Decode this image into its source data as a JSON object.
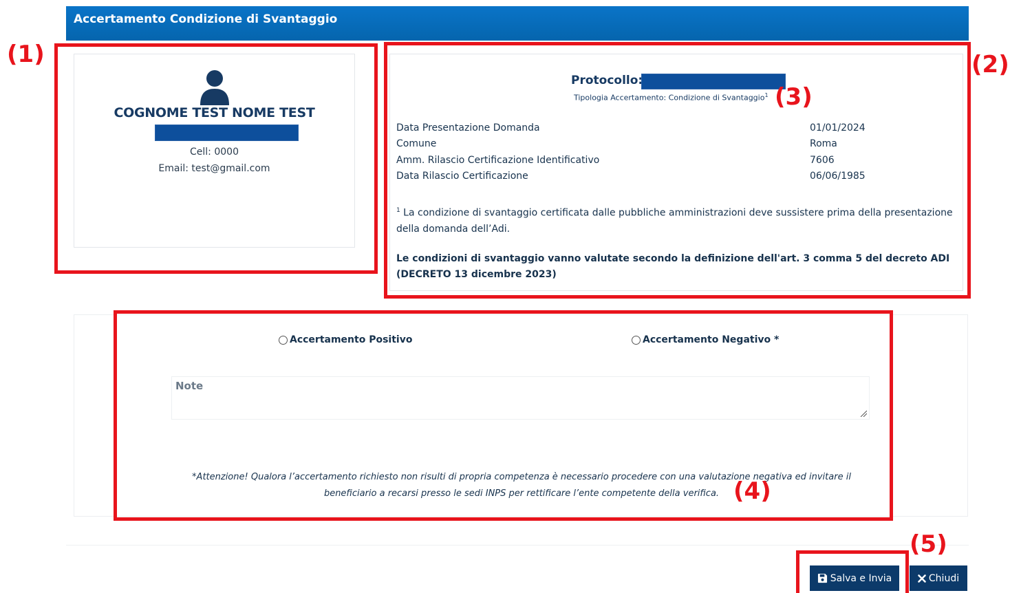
{
  "header": {
    "title": "Accertamento Condizione di Svantaggio"
  },
  "markers": {
    "m1": "(1)",
    "m2": "(2)",
    "m3": "(3)",
    "m4": "(4)",
    "m5": "(5)"
  },
  "user": {
    "name": "COGNOME TEST NOME TEST",
    "cell": "Cell: 0000",
    "email": "Email: test@gmail.com"
  },
  "details": {
    "protocol_label": "Protocollo:",
    "tipologia": "Tipologia Accertamento: Condizione di Svantaggio",
    "tipologia_sup": "1",
    "rows": [
      {
        "label": "Data Presentazione Domanda",
        "value": "01/01/2024"
      },
      {
        "label": "Comune",
        "value": "Roma"
      },
      {
        "label": "Amm. Rilascio Certificazione Identificativo",
        "value": "7606"
      },
      {
        "label": "Data Rilascio Certificazione",
        "value": "06/06/1985"
      }
    ],
    "footnote_sup": "1",
    "footnote": " La condizione di svantaggio certificata dalle pubbliche amministrazioni deve sussistere prima della presentazione della domanda dell’Adi.",
    "bold_note": "Le condizioni di svantaggio vanno valutate secondo la definizione dell'art. 3 comma 5 del decreto ADI (DECRETO 13 dicembre 2023)"
  },
  "form": {
    "radio_positive": "Accertamento Positivo",
    "radio_negative": "Accertamento Negativo *",
    "note_placeholder": "Note",
    "warning": "*Attenzione! Qualora l’accertamento richiesto non risulti di propria competenza è necessario procedere con una valutazione negativa ed invitare il beneficiario a recarsi presso le sedi INPS per rettificare l’ente competente della verifica."
  },
  "actions": {
    "save_label": "Salva e Invia",
    "close_label": "Chiudi"
  },
  "colors": {
    "header": "#0a6fc0",
    "annotation": "#e8141c",
    "button": "#0c3a6a",
    "mask": "#0d4f9c"
  }
}
